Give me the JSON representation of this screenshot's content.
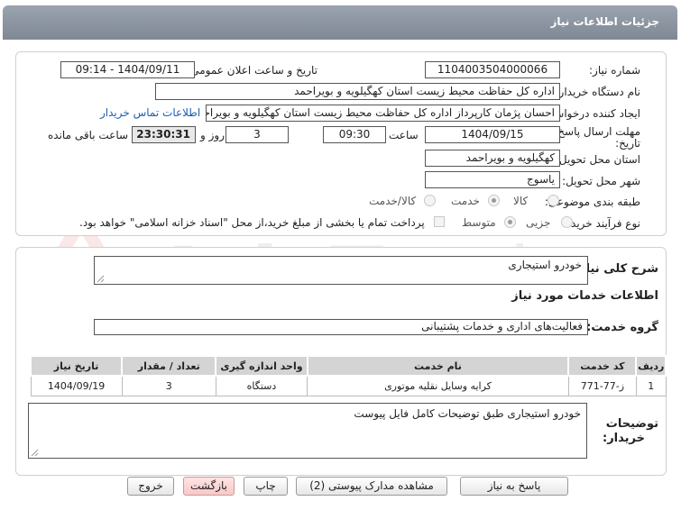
{
  "header": {
    "title": "جزئیات اطلاعات نیاز"
  },
  "form": {
    "need_number_label": "شماره نیاز:",
    "need_number": "1104003504000066",
    "announce_label": "تاریخ و ساعت اعلان عمومی:",
    "announce_value": "1404/09/11 - 09:14",
    "buyer_org_label": "نام دستگاه خریدار:",
    "buyer_org": "اداره کل حفاظت محیط زیست استان کهگیلویه و بویراحمد",
    "requester_label": "ایجاد کننده درخواست:",
    "requester": "احسان پژمان کارپرداز اداره کل حفاظت محیط زیست استان کهگیلویه و بویراحمد",
    "contact_link": "اطلاعات تماس خریدار",
    "deadline_label_1": "مهلت ارسال پاسخ: تا",
    "deadline_label_2": "تاریخ:",
    "deadline_date": "1404/09/15",
    "time_label": "ساعت",
    "deadline_time": "09:30",
    "days_value": "3",
    "days_label": "روز و",
    "remaining_time": "23:30:31",
    "remaining_label": "ساعت باقی مانده",
    "province_label": "استان محل تحویل:",
    "province": "کهگیلویه و بویراحمد",
    "city_label": "شهر محل تحویل:",
    "city": "یاسوج",
    "category_label": "طبقه بندی موضوعی:",
    "category_options": [
      "کالا",
      "خدمت",
      "کالا/خدمت"
    ],
    "category_selected": "خدمت",
    "purchase_type_label": "نوع فرآیند خرید :",
    "purchase_options": [
      "جزیی",
      "متوسط"
    ],
    "purchase_selected": "متوسط",
    "payment_note": "پرداخت تمام یا بخشی از مبلغ خرید،از محل \"اسناد خزانه اسلامی\" خواهد بود."
  },
  "summary": {
    "label": "شرح کلی نیاز:",
    "value": "خودرو استیجاری",
    "services_header": "اطلاعات خدمات مورد نیاز",
    "service_group_label": "گروه خدمت:",
    "service_group": "فعالیت‌های اداری و خدمات پشتیبانی"
  },
  "table": {
    "headers": [
      "ردیف",
      "کد خدمت",
      "نام خدمت",
      "واحد اندازه گیری",
      "تعداد / مقدار",
      "تاریخ نیاز"
    ],
    "rows": [
      [
        "1",
        "ز-77-771",
        "کرایه وسایل نقلیه موتوری",
        "دستگاه",
        "3",
        "1404/09/19"
      ]
    ]
  },
  "buyer_notes": {
    "label_1": "توضیحات",
    "label_2": "خریدار:",
    "value": "خودرو استیجاری طبق توضیحات کامل فایل پیوست"
  },
  "buttons": {
    "reply": "پاسخ به نیاز",
    "attachments": "مشاهده مدارک پیوستی (2)",
    "print": "چاپ",
    "back": "بازگشت",
    "exit": "خروج"
  },
  "watermark": {
    "text": "AriaTender.neT"
  },
  "colors": {
    "header_bg": "#8c96a2",
    "link": "#1a5fb4",
    "pink_button": "#f8c8c8"
  }
}
